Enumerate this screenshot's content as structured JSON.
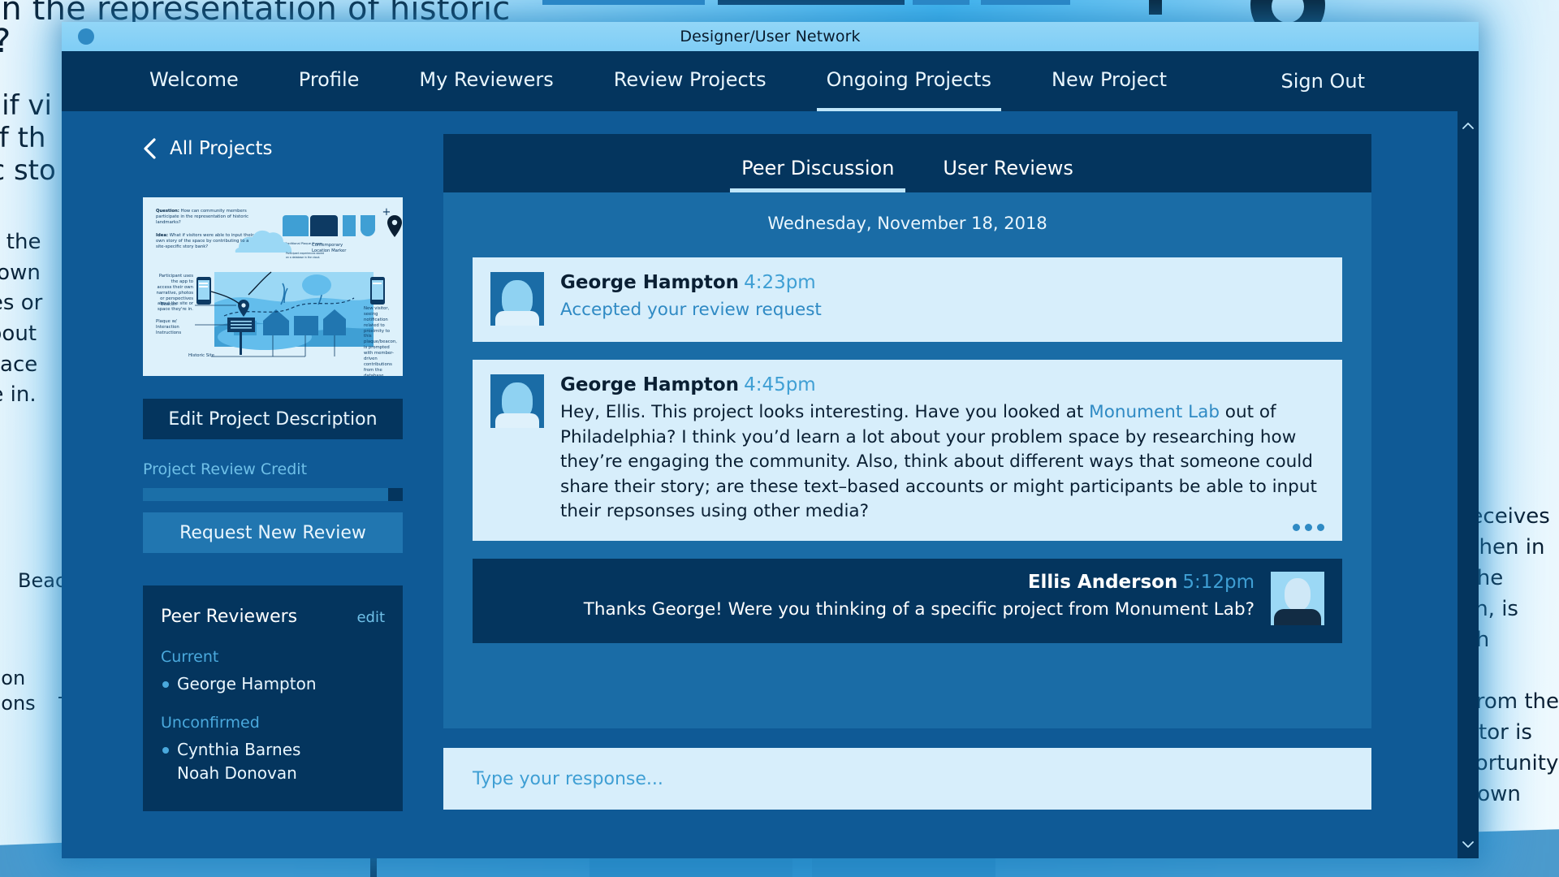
{
  "backdrop": {
    "heading_line1": "in the representation of historic",
    "heading_line2": "?",
    "body_left": "t if vi\nof th\nic sto",
    "body_left2": "es the\nir own\nries or\nabout\nspace\n’re in.",
    "beacon_label": "Beaco",
    "footer_left": "ction\nctions",
    "body_right": "receives\nwhen in\n the\non, is\nith\ny\n from the\nsitor is\nportunity\nr own\ne"
  },
  "window": {
    "title": "Designer/User Network",
    "dot_icon": "window-dot"
  },
  "nav": {
    "items": [
      {
        "label": "Welcome",
        "active": false
      },
      {
        "label": "Profile",
        "active": false
      },
      {
        "label": "My Reviewers",
        "active": false
      },
      {
        "label": "Review Projects",
        "active": false
      },
      {
        "label": "Ongoing Projects",
        "active": true
      },
      {
        "label": "New Project",
        "active": false
      }
    ],
    "signout_label": "Sign Out"
  },
  "sidebar": {
    "back_label": "All Projects",
    "back_icon": "chevron-left-icon",
    "thumbnail": {
      "question_label": "Question:",
      "question_text": " How can community members participate in the representation of historic landmarks?",
      "idea_label": "Idea:",
      "idea_text": " What if visitors were able to input their own story of the space by contributing to a site-specific story bank?",
      "caption_shapes": "Traditional Plaque Shapes",
      "caption_marker": "Contemporary Location Marker",
      "note_cloud": "Participant experiences stored on a database in the cloud.",
      "note_phone_left": "Participant uses the app to access their own narrative, photos or perspectives about the site or space they're in.",
      "note_phone_right": "New visitor, seeing notification related to proximity to this plaque/beacon, is prompted with member-driven contributions from the database. Visitor is given the opportunity to share their own story and the viewpoint.",
      "label_beacon": "Beacon",
      "label_plaque": "Plaque w/ Interaction Instructions",
      "label_site": "Historic Site",
      "plus_symbol": "+"
    },
    "edit_button": "Edit Project Description",
    "credit_label": "Project Review Credit",
    "request_button": "Request New Review",
    "reviewers": {
      "title": "Peer Reviewers",
      "edit_link": "edit",
      "groups": [
        {
          "label": "Current",
          "names": [
            "George Hampton"
          ]
        },
        {
          "label": "Unconfirmed",
          "names": [
            "Cynthia Barnes",
            "Noah Donovan"
          ]
        }
      ]
    }
  },
  "discussion": {
    "tabs": [
      {
        "label": "Peer Discussion",
        "active": true
      },
      {
        "label": "User Reviews",
        "active": false
      }
    ],
    "date": "Wednesday, November 18, 2018",
    "messages": [
      {
        "author": "George Hampton",
        "time": "4:23pm",
        "body": "Accepted your review request",
        "style": "link",
        "outgoing": false,
        "avatar": "george-avatar",
        "typing": false
      },
      {
        "author": "George Hampton",
        "time": "4:45pm",
        "body_pre": "Hey, Ellis. This project looks interesting. Have you looked at ",
        "body_link": "Monument Lab",
        "body_post": " out of Philadelphia? I think you’d learn a lot about your problem space by researching how they’re engaging the community. Also, think about different ways that someone could share their story; are these text–based accounts or might participants be able to input their repsonses using other media?",
        "outgoing": false,
        "avatar": "george-avatar",
        "typing": true
      },
      {
        "author": "Ellis Anderson",
        "time": "5:12pm",
        "body": "Thanks George! Were you thinking of a specific project from Monument Lab?",
        "outgoing": true,
        "avatar": "ellis-avatar",
        "typing": false
      }
    ],
    "reply_placeholder": "Type your response..."
  },
  "scrollbar": {
    "up_icon": "chevron-up-icon",
    "down_icon": "chevron-down-icon"
  },
  "colors": {
    "window_bg": "#0f5a96",
    "nav_bg": "#04355e",
    "accent": "#bfe6fa",
    "thread_bg": "#1a6ca6",
    "bubble_in": "#d7eefb",
    "bubble_out": "#04355e",
    "link": "#2f8ac4"
  }
}
